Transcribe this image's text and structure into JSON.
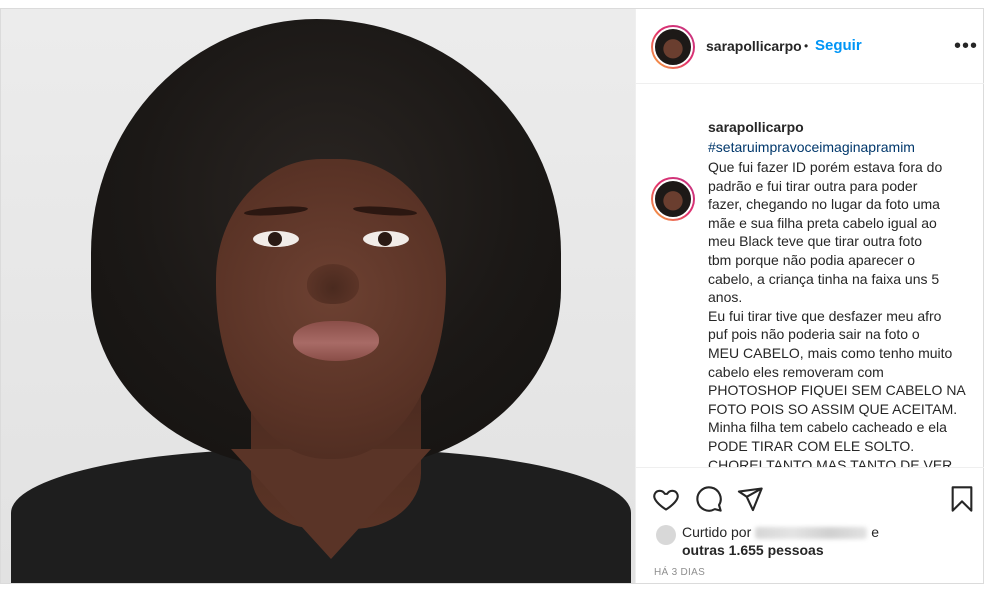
{
  "post": {
    "username": "sarapollicarpo",
    "follow_label": "Seguir",
    "more_label": "•••",
    "dot": "•"
  },
  "comment": {
    "username": "sarapollicarpo",
    "hashtag": "#setaruimpravoceimaginapramim",
    "caption": "Que fui fazer ID porém estava fora do\npadrão e fui tirar outra para poder\nfazer, chegando no lugar da foto uma\nmãe e sua filha preta cabelo igual ao\nmeu Black teve que tirar outra foto\ntbm porque não podia aparecer o\ncabelo, a criança tinha na faixa uns 5\nanos.\nEu fui tirar tive que desfazer meu afro\npuf pois não poderia sair na foto o\nMEU CABELO, mais como tenho muito\ncabelo eles removeram com\nPHOTOSHOP FIQUEI SEM CABELO NA\nFOTO POIS SO ASSIM QUE ACEITAM.\nMinha filha tem cabelo cacheado e ela\nPODE TIRAR COM ELE SOLTO.\nCHOREI TANTO MAS TANTO DE VER"
  },
  "likes": {
    "prefix": "Curtido por",
    "suffix": "e",
    "others": "outras 1.655 pessoas"
  },
  "time": "HÁ 3 DIAS",
  "icons": {
    "heart": "heart-icon",
    "comment": "comment-icon",
    "share": "share-icon",
    "save": "bookmark-icon",
    "more": "more-options-icon"
  },
  "colors": {
    "link": "#0095f6",
    "hashtag": "#00376b",
    "text": "#262626",
    "muted": "#8e8e8e"
  }
}
